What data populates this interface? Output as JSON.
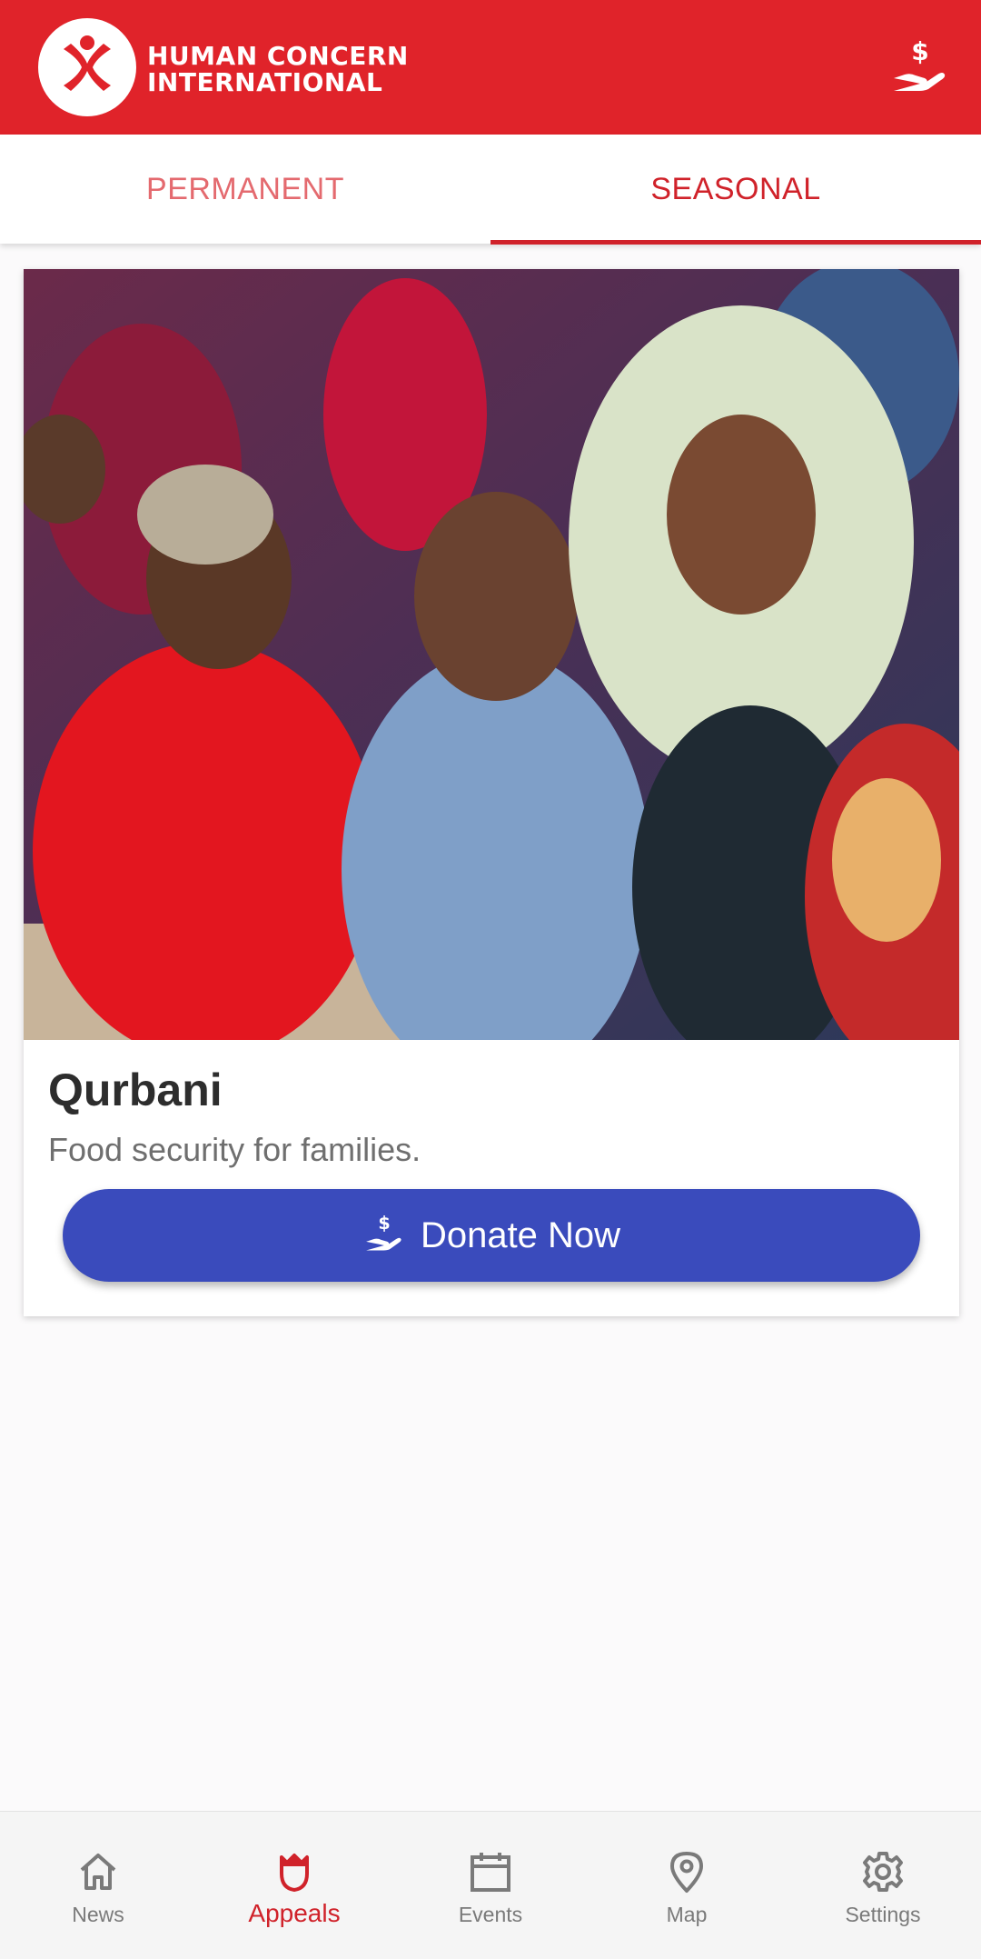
{
  "header": {
    "logo_line1": "HUMAN CONCERN",
    "logo_line2": "INTERNATIONAL",
    "logo_icon": "hci-logo",
    "donate_icon": "hand-dollar-icon"
  },
  "tabs": [
    {
      "label": "PERMANENT",
      "active": false
    },
    {
      "label": "SEASONAL",
      "active": true
    }
  ],
  "appeal": {
    "image": "photo of smiling children waving",
    "title": "Qurbani",
    "subtitle": "Food security for families.",
    "button_label": "Donate Now",
    "button_icon": "hand-dollar-icon"
  },
  "bottom_nav": [
    {
      "label": "News",
      "icon": "home-icon",
      "active": false
    },
    {
      "label": "Appeals",
      "icon": "appeals-icon",
      "active": true
    },
    {
      "label": "Events",
      "icon": "calendar-icon",
      "active": false
    },
    {
      "label": "Map",
      "icon": "map-pin-icon",
      "active": false
    },
    {
      "label": "Settings",
      "icon": "gear-icon",
      "active": false
    }
  ],
  "colors": {
    "brand_red": "#e0232a",
    "tab_active": "#d0222a",
    "button_blue": "#3a4bbc",
    "nav_inactive": "#7a7a7a"
  }
}
